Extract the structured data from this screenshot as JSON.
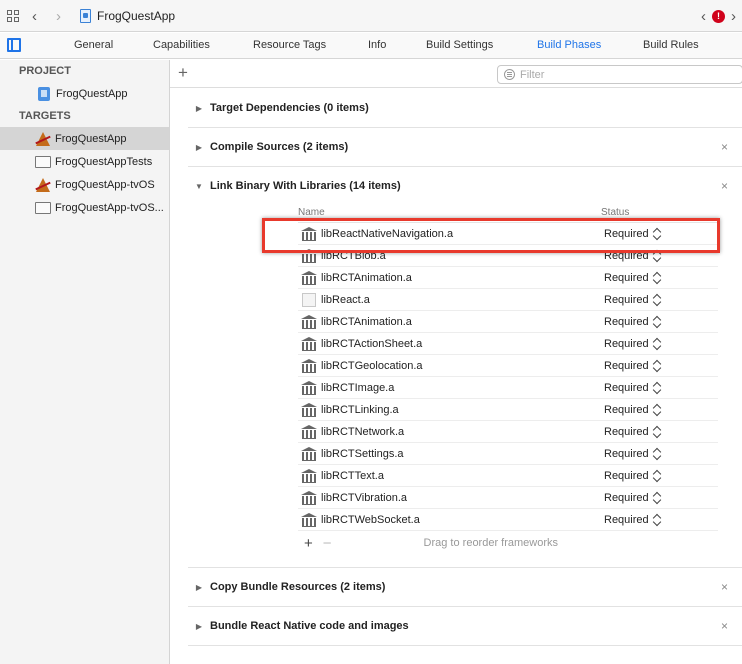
{
  "jumpbar": {
    "title": "FrogQuestApp",
    "error_badge": "!"
  },
  "tabs": [
    {
      "label": "General",
      "active": false
    },
    {
      "label": "Capabilities",
      "active": false
    },
    {
      "label": "Resource Tags",
      "active": false
    },
    {
      "label": "Info",
      "active": false
    },
    {
      "label": "Build Settings",
      "active": false
    },
    {
      "label": "Build Phases",
      "active": true
    },
    {
      "label": "Build Rules",
      "active": false
    }
  ],
  "sidebar": {
    "project_header": "PROJECT",
    "project_item": "FrogQuestApp",
    "targets_header": "TARGETS",
    "targets": [
      {
        "label": "FrogQuestApp",
        "icon": "app-target-icon",
        "selected": true
      },
      {
        "label": "FrogQuestAppTests",
        "icon": "test-bundle-icon",
        "selected": false
      },
      {
        "label": "FrogQuestApp-tvOS",
        "icon": "app-target-icon",
        "selected": false
      },
      {
        "label": "FrogQuestApp-tvOS...",
        "icon": "test-bundle-icon",
        "selected": false
      }
    ]
  },
  "toolbar": {
    "add_label": "+",
    "filter_placeholder": "Filter"
  },
  "phases": [
    {
      "title": "Target Dependencies (0 items)",
      "expanded": false,
      "closable": false
    },
    {
      "title": "Compile Sources (2 items)",
      "expanded": false,
      "closable": true
    },
    {
      "title": "Link Binary With Libraries (14 items)",
      "expanded": true,
      "closable": true
    },
    {
      "title": "Copy Bundle Resources (2 items)",
      "expanded": false,
      "closable": true
    },
    {
      "title": "Bundle React Native code and images",
      "expanded": false,
      "closable": true
    }
  ],
  "library_table": {
    "name_header": "Name",
    "status_header": "Status",
    "rows": [
      {
        "name": "libReactNativeNavigation.a",
        "status": "Required",
        "icon": "library-icon"
      },
      {
        "name": "libRCTBlob.a",
        "status": "Required",
        "icon": "library-icon"
      },
      {
        "name": "libRCTAnimation.a",
        "status": "Required",
        "icon": "library-icon"
      },
      {
        "name": "libReact.a",
        "status": "Required",
        "icon": "blank-library-icon"
      },
      {
        "name": "libRCTAnimation.a",
        "status": "Required",
        "icon": "library-icon"
      },
      {
        "name": "libRCTActionSheet.a",
        "status": "Required",
        "icon": "library-icon"
      },
      {
        "name": "libRCTGeolocation.a",
        "status": "Required",
        "icon": "library-icon"
      },
      {
        "name": "libRCTImage.a",
        "status": "Required",
        "icon": "library-icon"
      },
      {
        "name": "libRCTLinking.a",
        "status": "Required",
        "icon": "library-icon"
      },
      {
        "name": "libRCTNetwork.a",
        "status": "Required",
        "icon": "library-icon"
      },
      {
        "name": "libRCTSettings.a",
        "status": "Required",
        "icon": "library-icon"
      },
      {
        "name": "libRCTText.a",
        "status": "Required",
        "icon": "library-icon"
      },
      {
        "name": "libRCTVibration.a",
        "status": "Required",
        "icon": "library-icon"
      },
      {
        "name": "libRCTWebSocket.a",
        "status": "Required",
        "icon": "library-icon"
      }
    ],
    "add_label": "+",
    "remove_label": "−",
    "drag_hint": "Drag to reorder frameworks"
  },
  "colors": {
    "accent": "#1f74e8",
    "highlight": "#e8392c",
    "error": "#d0021b"
  },
  "close_glyph": "×"
}
